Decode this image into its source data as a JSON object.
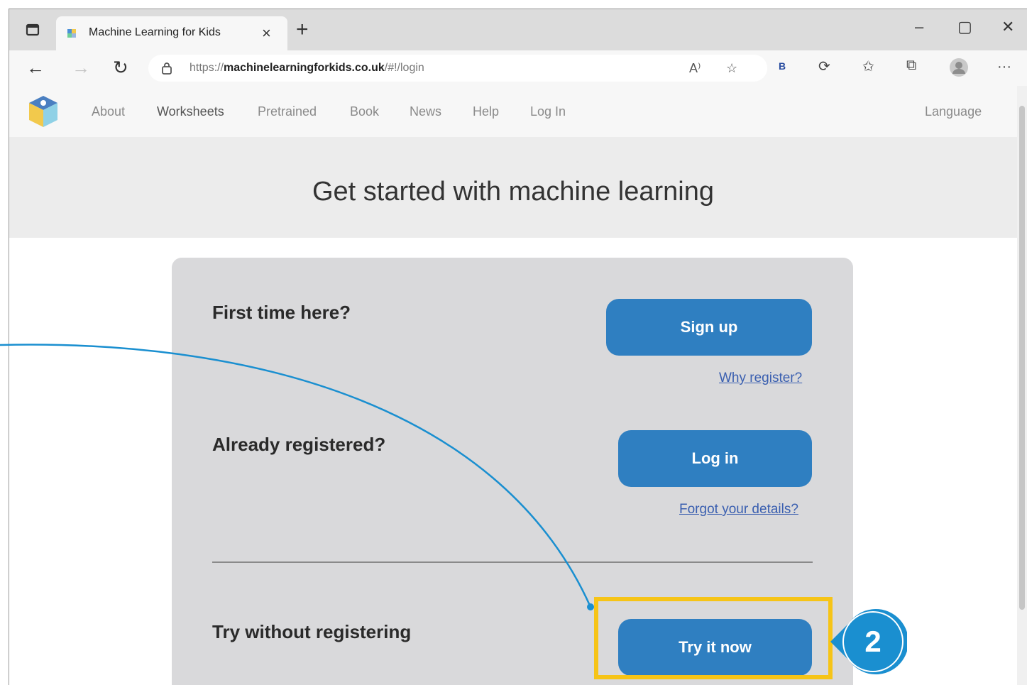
{
  "browser": {
    "tab_title": "Machine Learning for Kids",
    "tab_close": "×",
    "new_tab": "+",
    "window_controls": {
      "minimize": "–",
      "maximize": "▢",
      "close": "✕"
    },
    "url_host": "https://machinelearningforkids.co.uk",
    "url_rest": "/#!/login",
    "url_host_prefix": "https://",
    "url_host_bold": "machinelearningforkids.co.uk",
    "read_aloud": "A⁾",
    "more": "···",
    "extension_badge": "B"
  },
  "site_nav": {
    "items": [
      "About",
      "Worksheets",
      "Pretrained",
      "Book",
      "News",
      "Help",
      "Log In"
    ],
    "active": "Worksheets",
    "language": "Language"
  },
  "hero": {
    "title": "Get started with machine learning"
  },
  "login_card": {
    "first_time": "First time here?",
    "signup_button": "Sign up",
    "why_register": "Why register?",
    "already_registered": "Already registered?",
    "login_button": "Log in",
    "forgot": "Forgot your details?",
    "try_without": "Try without registering",
    "try_button": "Try it now"
  },
  "annotation": {
    "step_number": "2",
    "highlight_color": "#f6c417",
    "callout_color": "#1a8fd0"
  },
  "colors": {
    "primary_button": "#2f7fc1",
    "link": "#3a5fb0"
  },
  "icons": [
    "tab-actions-icon",
    "favicon-icon",
    "back-icon",
    "forward-icon",
    "refresh-icon",
    "lock-icon",
    "read-aloud-icon",
    "add-favorite-icon",
    "extension-icon",
    "copilot-icon",
    "favorites-icon",
    "collections-icon",
    "profile-icon",
    "more-icon",
    "site-logo-icon"
  ]
}
